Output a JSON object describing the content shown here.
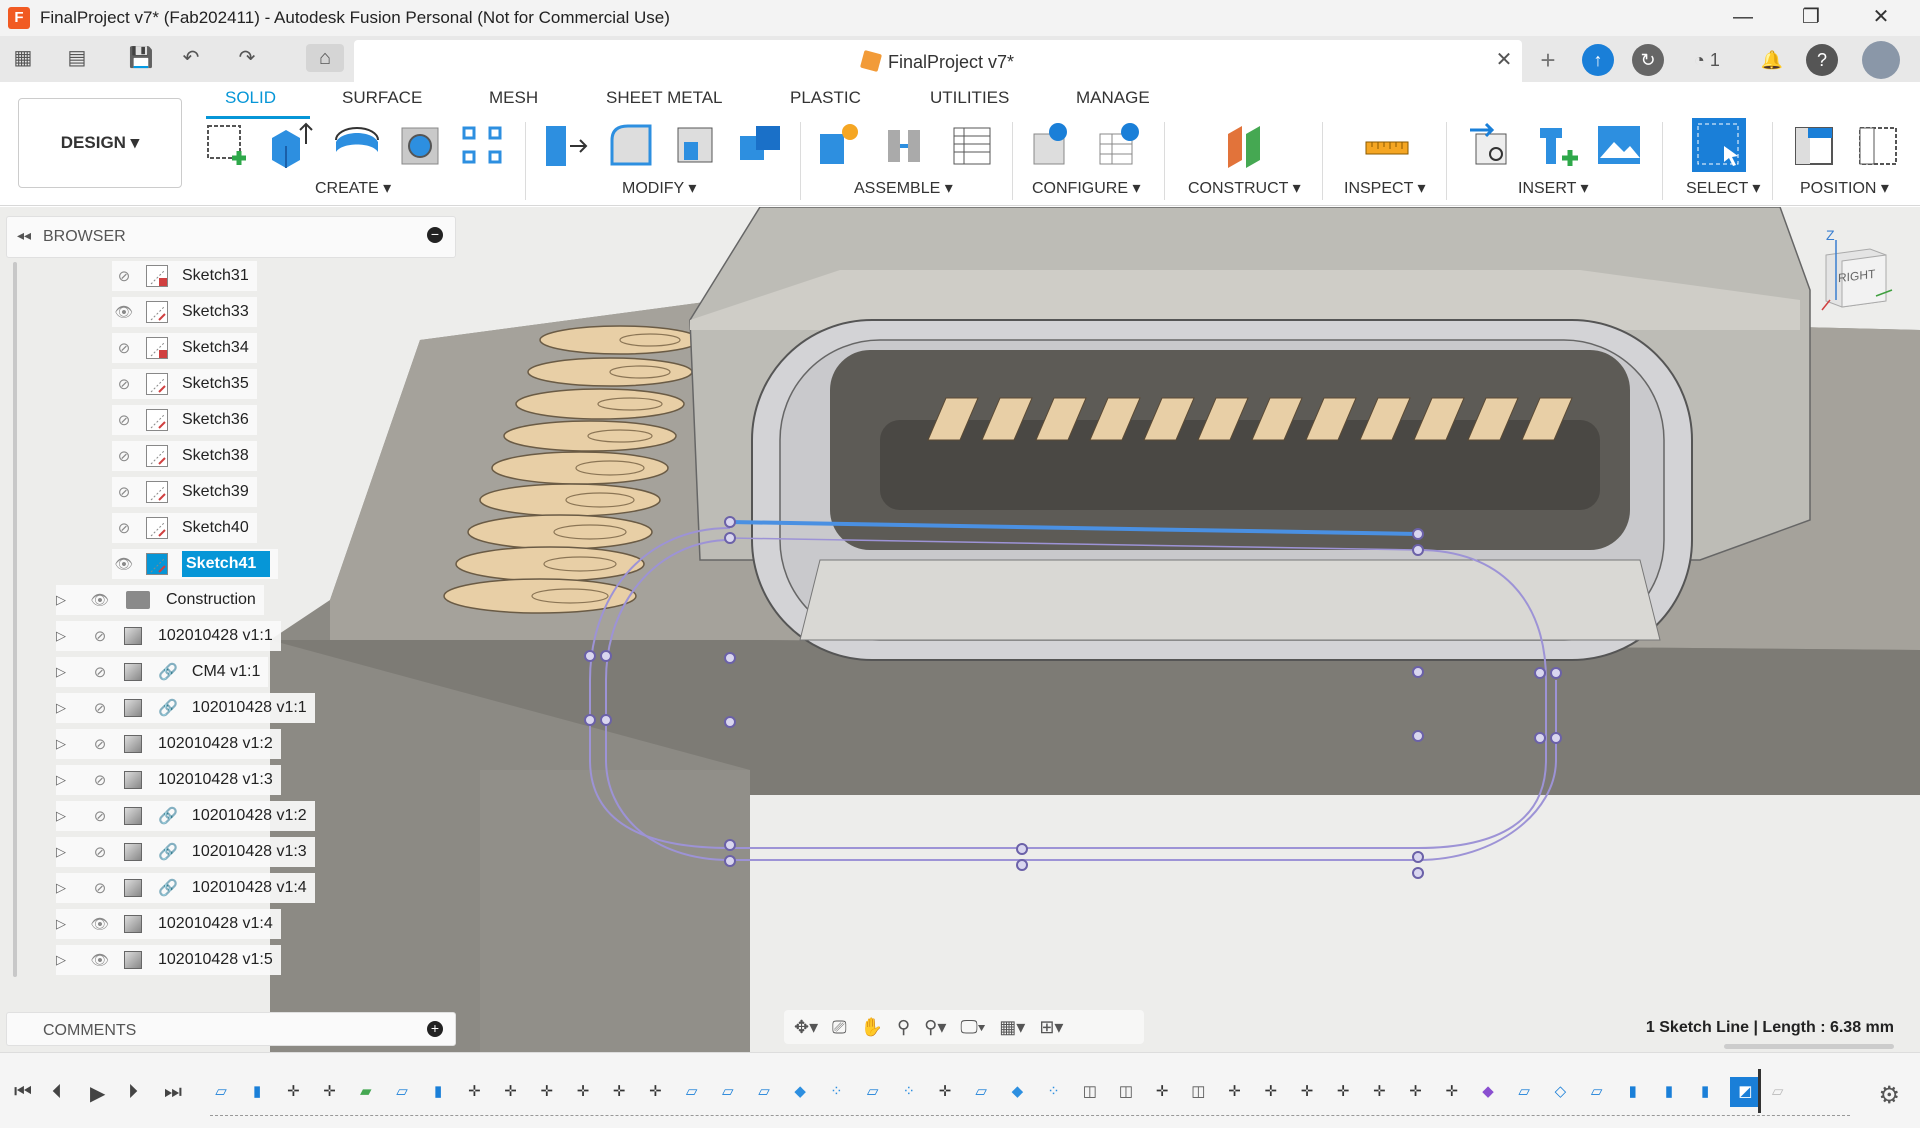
{
  "window": {
    "title": "FinalProject v7* (Fab202411) - Autodesk Fusion Personal (Not for Commercial Use)",
    "app_logo_letter": "F",
    "controls": [
      "—",
      "❐",
      "✕"
    ]
  },
  "doc_tab": {
    "name": "FinalProject v7*",
    "close_glyph": "✕",
    "notification_count": "1"
  },
  "workspace_tabs": [
    {
      "label": "SOLID",
      "active": true
    },
    {
      "label": "SURFACE",
      "active": false
    },
    {
      "label": "MESH",
      "active": false
    },
    {
      "label": "SHEET METAL",
      "active": false
    },
    {
      "label": "PLASTIC",
      "active": false
    },
    {
      "label": "UTILITIES",
      "active": false
    },
    {
      "label": "MANAGE",
      "active": false
    }
  ],
  "design_button": "DESIGN ▾",
  "tool_groups": [
    "CREATE ▾",
    "MODIFY ▾",
    "ASSEMBLE ▾",
    "CONFIGURE ▾",
    "CONSTRUCT ▾",
    "INSPECT ▾",
    "INSERT ▾",
    "SELECT ▾",
    "POSITION ▾"
  ],
  "browser": {
    "title": "BROWSER",
    "sketches": [
      {
        "label": "Sketch31",
        "visible": false,
        "locked": true
      },
      {
        "label": "Sketch33",
        "visible": true,
        "locked": false
      },
      {
        "label": "Sketch34",
        "visible": false,
        "locked": true
      },
      {
        "label": "Sketch35",
        "visible": false,
        "locked": false
      },
      {
        "label": "Sketch36",
        "visible": false,
        "locked": false
      },
      {
        "label": "Sketch38",
        "visible": false,
        "locked": false
      },
      {
        "label": "Sketch39",
        "visible": false,
        "locked": false
      },
      {
        "label": "Sketch40",
        "visible": false,
        "locked": false
      },
      {
        "label": "Sketch41",
        "visible": true,
        "locked": false,
        "selected": true
      }
    ],
    "folder": {
      "label": "Construction",
      "visible": true
    },
    "components": [
      {
        "label": "102010428 v1:1",
        "visible": false,
        "linked": false
      },
      {
        "label": "CM4 v1:1",
        "visible": false,
        "linked": true
      },
      {
        "label": "102010428 v1:1",
        "visible": false,
        "linked": true
      },
      {
        "label": "102010428 v1:2",
        "visible": false,
        "linked": false
      },
      {
        "label": "102010428 v1:3",
        "visible": false,
        "linked": false
      },
      {
        "label": "102010428 v1:2",
        "visible": false,
        "linked": true
      },
      {
        "label": "102010428 v1:3",
        "visible": false,
        "linked": true
      },
      {
        "label": "102010428 v1:4",
        "visible": false,
        "linked": true
      },
      {
        "label": "102010428 v1:4",
        "visible": true,
        "linked": false
      },
      {
        "label": "102010428 v1:5",
        "visible": true,
        "linked": false
      }
    ]
  },
  "comments": {
    "title": "COMMENTS"
  },
  "viewcube": {
    "face": "RIGHT",
    "axis_z": "Z"
  },
  "status_text": "1 Sketch Line | Length : 6.38 mm",
  "colors": {
    "accent": "#0696d7",
    "selection_bg": "#0696d7",
    "sketch_line": "#9d93d6",
    "selected_line": "#4a90e2",
    "pad_color": "#e8cfa6"
  }
}
